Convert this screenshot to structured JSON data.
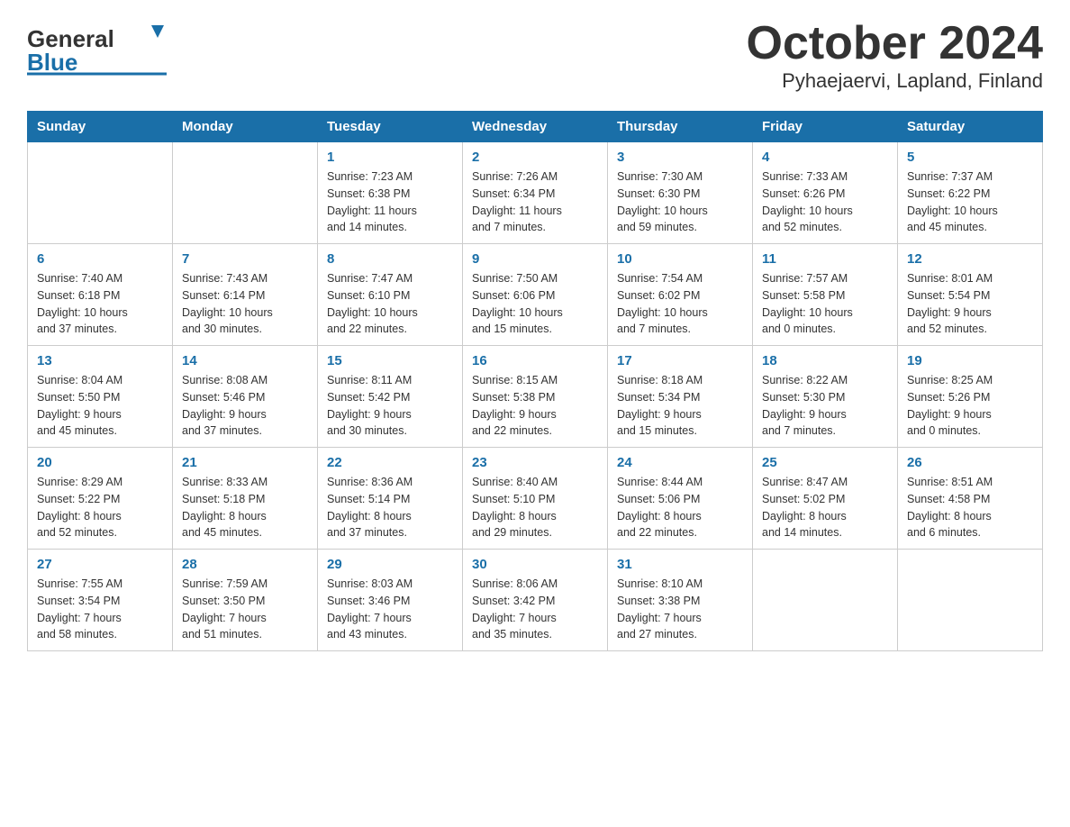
{
  "header": {
    "logo_general": "General",
    "logo_blue": "Blue",
    "title": "October 2024",
    "subtitle": "Pyhaejaervi, Lapland, Finland"
  },
  "days_of_week": [
    "Sunday",
    "Monday",
    "Tuesday",
    "Wednesday",
    "Thursday",
    "Friday",
    "Saturday"
  ],
  "weeks": [
    [
      {
        "date": "",
        "info": ""
      },
      {
        "date": "",
        "info": ""
      },
      {
        "date": "1",
        "info": "Sunrise: 7:23 AM\nSunset: 6:38 PM\nDaylight: 11 hours\nand 14 minutes."
      },
      {
        "date": "2",
        "info": "Sunrise: 7:26 AM\nSunset: 6:34 PM\nDaylight: 11 hours\nand 7 minutes."
      },
      {
        "date": "3",
        "info": "Sunrise: 7:30 AM\nSunset: 6:30 PM\nDaylight: 10 hours\nand 59 minutes."
      },
      {
        "date": "4",
        "info": "Sunrise: 7:33 AM\nSunset: 6:26 PM\nDaylight: 10 hours\nand 52 minutes."
      },
      {
        "date": "5",
        "info": "Sunrise: 7:37 AM\nSunset: 6:22 PM\nDaylight: 10 hours\nand 45 minutes."
      }
    ],
    [
      {
        "date": "6",
        "info": "Sunrise: 7:40 AM\nSunset: 6:18 PM\nDaylight: 10 hours\nand 37 minutes."
      },
      {
        "date": "7",
        "info": "Sunrise: 7:43 AM\nSunset: 6:14 PM\nDaylight: 10 hours\nand 30 minutes."
      },
      {
        "date": "8",
        "info": "Sunrise: 7:47 AM\nSunset: 6:10 PM\nDaylight: 10 hours\nand 22 minutes."
      },
      {
        "date": "9",
        "info": "Sunrise: 7:50 AM\nSunset: 6:06 PM\nDaylight: 10 hours\nand 15 minutes."
      },
      {
        "date": "10",
        "info": "Sunrise: 7:54 AM\nSunset: 6:02 PM\nDaylight: 10 hours\nand 7 minutes."
      },
      {
        "date": "11",
        "info": "Sunrise: 7:57 AM\nSunset: 5:58 PM\nDaylight: 10 hours\nand 0 minutes."
      },
      {
        "date": "12",
        "info": "Sunrise: 8:01 AM\nSunset: 5:54 PM\nDaylight: 9 hours\nand 52 minutes."
      }
    ],
    [
      {
        "date": "13",
        "info": "Sunrise: 8:04 AM\nSunset: 5:50 PM\nDaylight: 9 hours\nand 45 minutes."
      },
      {
        "date": "14",
        "info": "Sunrise: 8:08 AM\nSunset: 5:46 PM\nDaylight: 9 hours\nand 37 minutes."
      },
      {
        "date": "15",
        "info": "Sunrise: 8:11 AM\nSunset: 5:42 PM\nDaylight: 9 hours\nand 30 minutes."
      },
      {
        "date": "16",
        "info": "Sunrise: 8:15 AM\nSunset: 5:38 PM\nDaylight: 9 hours\nand 22 minutes."
      },
      {
        "date": "17",
        "info": "Sunrise: 8:18 AM\nSunset: 5:34 PM\nDaylight: 9 hours\nand 15 minutes."
      },
      {
        "date": "18",
        "info": "Sunrise: 8:22 AM\nSunset: 5:30 PM\nDaylight: 9 hours\nand 7 minutes."
      },
      {
        "date": "19",
        "info": "Sunrise: 8:25 AM\nSunset: 5:26 PM\nDaylight: 9 hours\nand 0 minutes."
      }
    ],
    [
      {
        "date": "20",
        "info": "Sunrise: 8:29 AM\nSunset: 5:22 PM\nDaylight: 8 hours\nand 52 minutes."
      },
      {
        "date": "21",
        "info": "Sunrise: 8:33 AM\nSunset: 5:18 PM\nDaylight: 8 hours\nand 45 minutes."
      },
      {
        "date": "22",
        "info": "Sunrise: 8:36 AM\nSunset: 5:14 PM\nDaylight: 8 hours\nand 37 minutes."
      },
      {
        "date": "23",
        "info": "Sunrise: 8:40 AM\nSunset: 5:10 PM\nDaylight: 8 hours\nand 29 minutes."
      },
      {
        "date": "24",
        "info": "Sunrise: 8:44 AM\nSunset: 5:06 PM\nDaylight: 8 hours\nand 22 minutes."
      },
      {
        "date": "25",
        "info": "Sunrise: 8:47 AM\nSunset: 5:02 PM\nDaylight: 8 hours\nand 14 minutes."
      },
      {
        "date": "26",
        "info": "Sunrise: 8:51 AM\nSunset: 4:58 PM\nDaylight: 8 hours\nand 6 minutes."
      }
    ],
    [
      {
        "date": "27",
        "info": "Sunrise: 7:55 AM\nSunset: 3:54 PM\nDaylight: 7 hours\nand 58 minutes."
      },
      {
        "date": "28",
        "info": "Sunrise: 7:59 AM\nSunset: 3:50 PM\nDaylight: 7 hours\nand 51 minutes."
      },
      {
        "date": "29",
        "info": "Sunrise: 8:03 AM\nSunset: 3:46 PM\nDaylight: 7 hours\nand 43 minutes."
      },
      {
        "date": "30",
        "info": "Sunrise: 8:06 AM\nSunset: 3:42 PM\nDaylight: 7 hours\nand 35 minutes."
      },
      {
        "date": "31",
        "info": "Sunrise: 8:10 AM\nSunset: 3:38 PM\nDaylight: 7 hours\nand 27 minutes."
      },
      {
        "date": "",
        "info": ""
      },
      {
        "date": "",
        "info": ""
      }
    ]
  ]
}
